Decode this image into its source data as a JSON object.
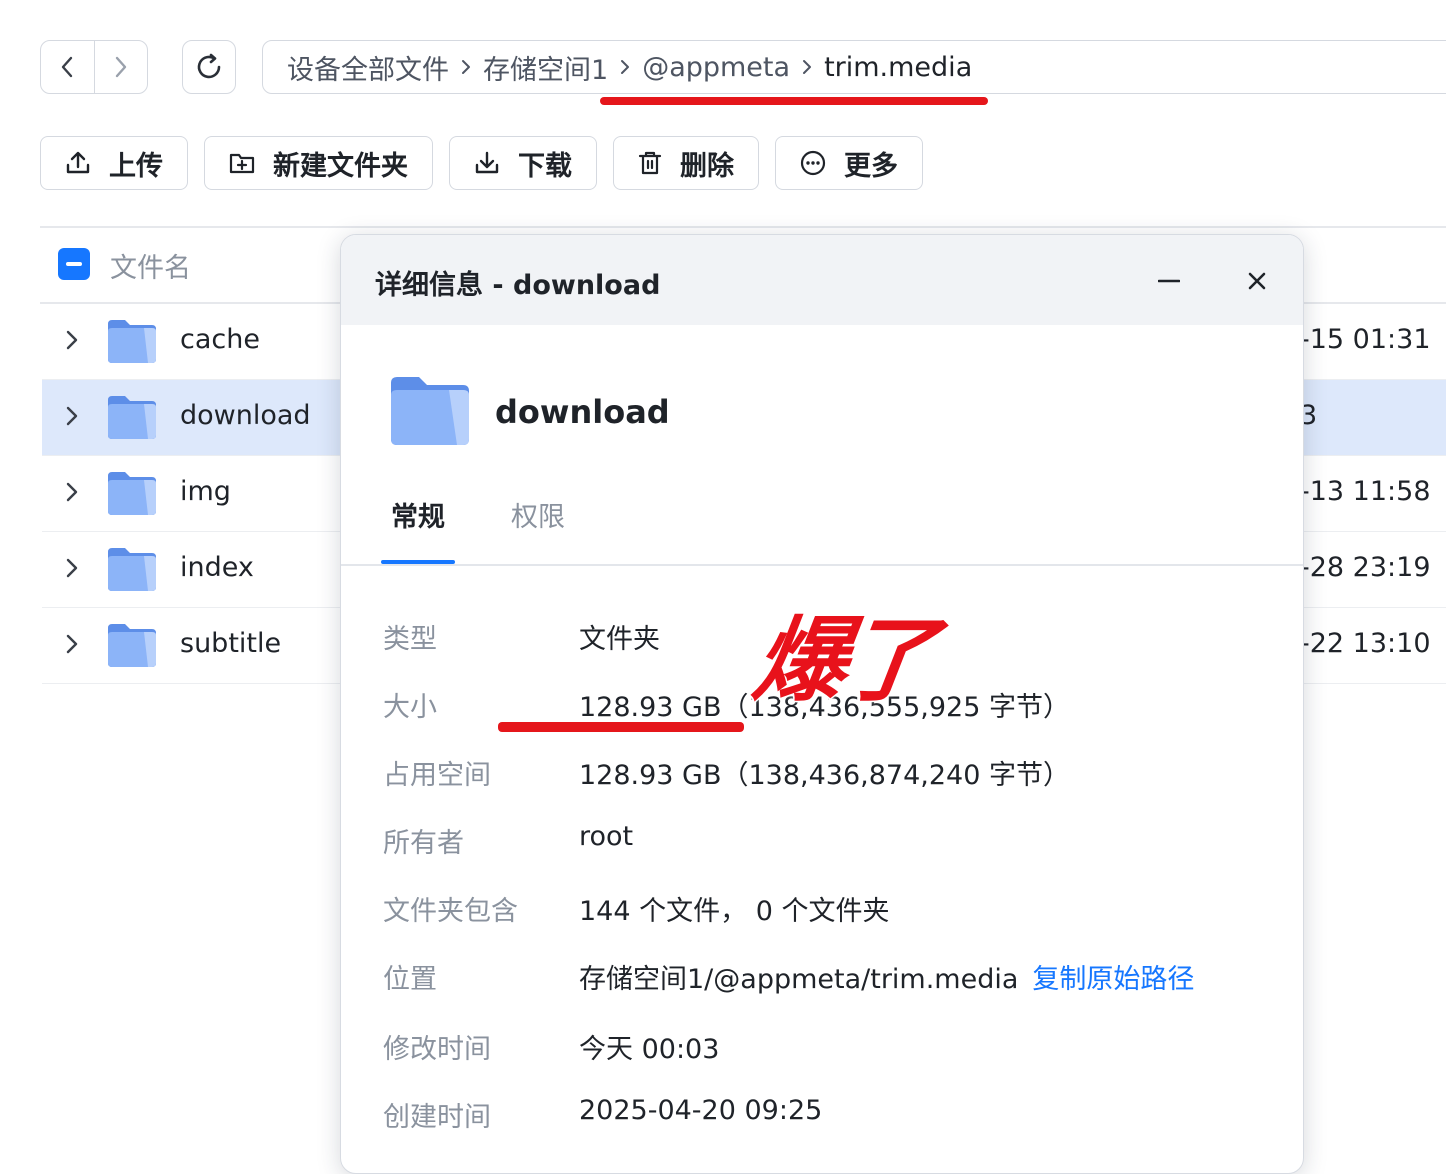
{
  "breadcrumb": {
    "items": [
      "设备全部文件",
      "存储空间1",
      "@appmeta",
      "trim.media"
    ]
  },
  "toolbar": {
    "upload": "上传",
    "new_folder": "新建文件夹",
    "download": "下载",
    "delete": "删除",
    "more": "更多"
  },
  "list": {
    "header_name": "文件名",
    "rows": [
      {
        "name": "cache",
        "date": "-15 01:31"
      },
      {
        "name": "download",
        "date": "3"
      },
      {
        "name": "img",
        "date": "-13 11:58"
      },
      {
        "name": "index",
        "date": "-28 23:19"
      },
      {
        "name": "subtitle",
        "date": "-22 13:10"
      }
    ]
  },
  "dialog": {
    "title": "详细信息 - download",
    "folder_name": "download",
    "tabs": [
      "常规",
      "权限"
    ],
    "fields": [
      {
        "label": "类型",
        "value": "文件夹"
      },
      {
        "label": "大小",
        "value": "128.93 GB（138,436,555,925 字节）"
      },
      {
        "label": "占用空间",
        "value": "128.93 GB（138,436,874,240 字节）"
      },
      {
        "label": "所有者",
        "value": "root"
      },
      {
        "label": "文件夹包含",
        "value": "144 个文件， 0 个文件夹"
      },
      {
        "label": "位置",
        "value": "存储空间1/@appmeta/trim.media",
        "link": "复制原始路径"
      },
      {
        "label": "修改时间",
        "value": "今天 00:03"
      },
      {
        "label": "创建时间",
        "value": "2025-04-20 09:25"
      }
    ]
  },
  "annotation": "爆了",
  "colors": {
    "accent": "#1677ff",
    "selected_row": "#dde8fb",
    "annotation_red": "#e5161b",
    "folder_blue": "#7aa7f5"
  }
}
